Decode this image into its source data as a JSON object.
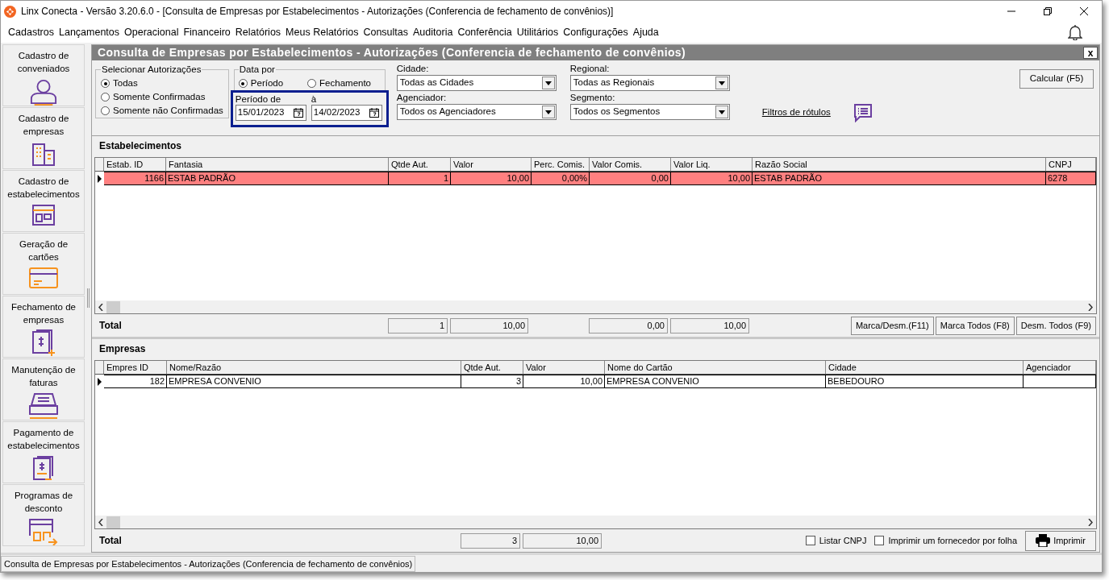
{
  "window": {
    "title": "Linx Conecta - Versão 3.20.6.0 - [Consulta de Empresas por Estabelecimentos - Autorizações (Conferencia de fechamento de convênios)]"
  },
  "menu": [
    "Cadastros",
    "Lançamentos",
    "Operacional",
    "Financeiro",
    "Relatórios",
    "Meus Relatórios",
    "Consultas",
    "Auditoria",
    "Conferência",
    "Utilitários",
    "Configurações",
    "Ajuda"
  ],
  "sidebar": {
    "items": [
      {
        "label": "Cadastro de conveniados"
      },
      {
        "label": "Cadastro de empresas"
      },
      {
        "label": "Cadastro de estabelecimentos"
      },
      {
        "label": "Geração de cartões"
      },
      {
        "label": "Fechamento de empresas"
      },
      {
        "label": "Manutenção de faturas"
      },
      {
        "label": "Pagamento de estabelecimentos"
      },
      {
        "label": "Programas de desconto"
      }
    ]
  },
  "form": {
    "title": "Consulta de Empresas por Estabelecimentos - Autorizações (Conferencia de fechamento de convênios)",
    "close": "x"
  },
  "filters": {
    "selecionar": {
      "label": "Selecionar Autorizações",
      "options": [
        {
          "label": "Todas",
          "selected": true
        },
        {
          "label": "Somente Confirmadas",
          "selected": false
        },
        {
          "label": "Somente não Confirmadas",
          "selected": false
        }
      ]
    },
    "data_por": {
      "label": "Data por",
      "options": [
        {
          "label": "Período",
          "selected": true
        },
        {
          "label": "Fechamento",
          "selected": false
        }
      ]
    },
    "periodo": {
      "from_label": "Período de",
      "from": "15/01/2023",
      "to_label": "à",
      "to": "14/02/2023"
    },
    "dropdowns": [
      {
        "label": "Cidade:",
        "value": "Todas as Cidades"
      },
      {
        "label": "Agenciador:",
        "value": "Todos os Agenciadores"
      },
      {
        "label": "Regional:",
        "value": "Todas as Regionais"
      },
      {
        "label": "Segmento:",
        "value": "Todos os Segmentos"
      }
    ],
    "link": "Filtros de rótulos",
    "calculate_button": "Calcular (F5)"
  },
  "panels": [
    {
      "title": "Estabelecimentos",
      "columns": [
        {
          "label": "Estab. ID",
          "numeric": true
        },
        {
          "label": "Fantasia",
          "numeric": false
        },
        {
          "label": "Qtde Aut.",
          "numeric": true,
          "total": "1"
        },
        {
          "label": "Valor",
          "numeric": true,
          "total": "10,00"
        },
        {
          "label": "Perc. Comis.",
          "numeric": true
        },
        {
          "label": "Valor Comis.",
          "numeric": true,
          "total": "0,00"
        },
        {
          "label": "Valor Liq.",
          "numeric": true,
          "total": "10,00"
        },
        {
          "label": "Razão Social",
          "numeric": false
        },
        {
          "label": "CNPJ",
          "numeric": false
        }
      ],
      "rows": [
        {
          "cells": [
            "1166",
            "ESTAB PADRÃO",
            "1",
            "10,00",
            "0,00%",
            "0,00",
            "10,00",
            "ESTAB PADRÃO",
            "6278"
          ],
          "current": true,
          "selected": true
        }
      ],
      "total_label": "Total",
      "buttons": [
        "Marca/Desm.(F11)",
        "Marca Todos (F8)",
        "Desm. Todos (F9)"
      ]
    },
    {
      "title": "Empresas",
      "columns": [
        {
          "label": "Empres ID",
          "numeric": true
        },
        {
          "label": "Nome/Razão",
          "numeric": false
        },
        {
          "label": "Qtde Aut.",
          "numeric": true,
          "total": "3"
        },
        {
          "label": "Valor",
          "numeric": true,
          "total": "10,00"
        },
        {
          "label": "Nome do Cartão",
          "numeric": false
        },
        {
          "label": "Cidade",
          "numeric": false
        },
        {
          "label": "Agenciador"
        }
      ],
      "rows": [
        {
          "cells": [
            "182",
            "EMPRESA CONVENIO",
            "3",
            "10,00",
            "EMPRESA  CONVENIO",
            "BEBEDOURO"
          ],
          "current": true,
          "selected": false
        }
      ],
      "total_label": "Total",
      "checkboxes": [
        {
          "label": "Listar CNPJ",
          "checked": false
        },
        {
          "label": "Imprimir um fornecedor por folha",
          "checked": false
        }
      ],
      "print_button": "Imprimir"
    }
  ],
  "status_bar": "Consulta de Empresas por Estabelecimentos - Autorizações (Conferencia de fechamento de convênios)"
}
